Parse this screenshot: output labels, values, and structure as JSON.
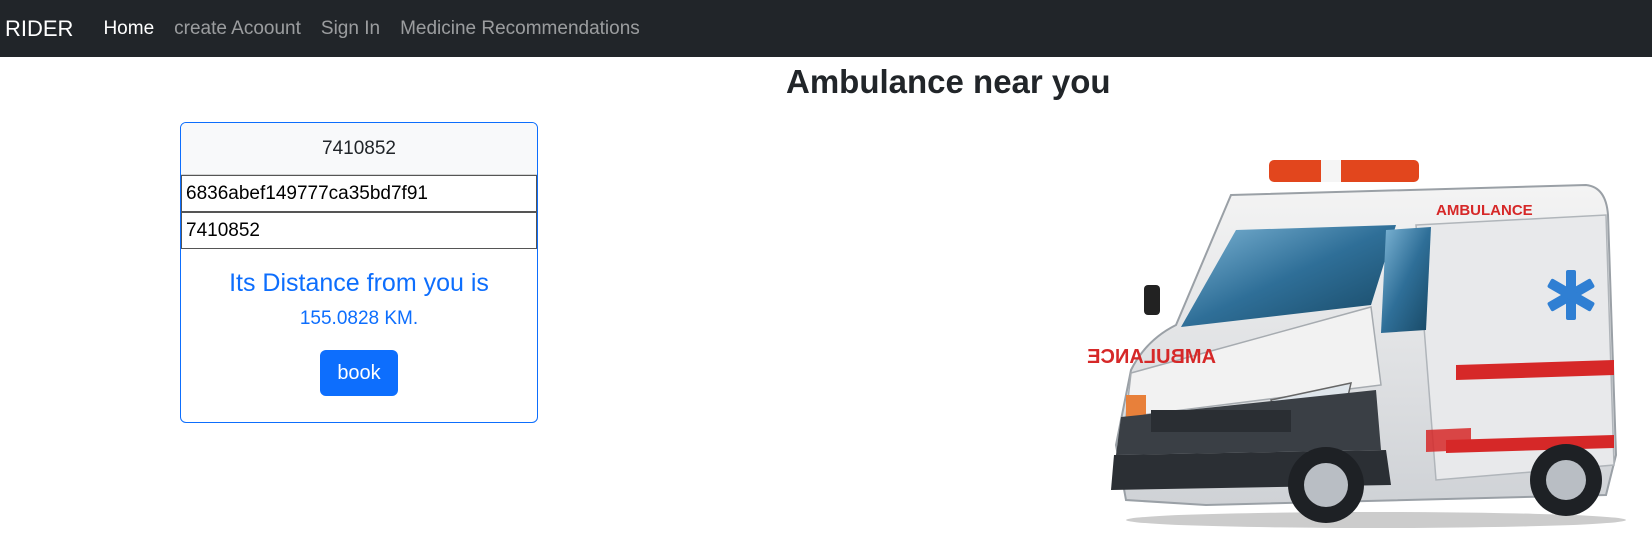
{
  "navbar": {
    "brand": "RIDER",
    "links": [
      {
        "label": "Home",
        "active": true
      },
      {
        "label": "create Acoount",
        "active": false
      },
      {
        "label": "Sign In",
        "active": false
      },
      {
        "label": "Medicine Recommendations",
        "active": false
      }
    ]
  },
  "page": {
    "title": "Ambulance near you"
  },
  "card": {
    "header": "7410852",
    "id_field_value": "6836abef149777ca35bd7f91",
    "phone_field_value": "7410852",
    "distance_title": "Its Distance from you is",
    "distance_value": "155.0828 KM.",
    "book_label": "book"
  },
  "image": {
    "icon": "ambulance-image",
    "side_text": "AMBULANCE",
    "hood_text": "AMBULANCE"
  },
  "colors": {
    "navbar_bg": "#212529",
    "primary": "#0d6efd",
    "card_header_bg": "#f8f9fa"
  }
}
